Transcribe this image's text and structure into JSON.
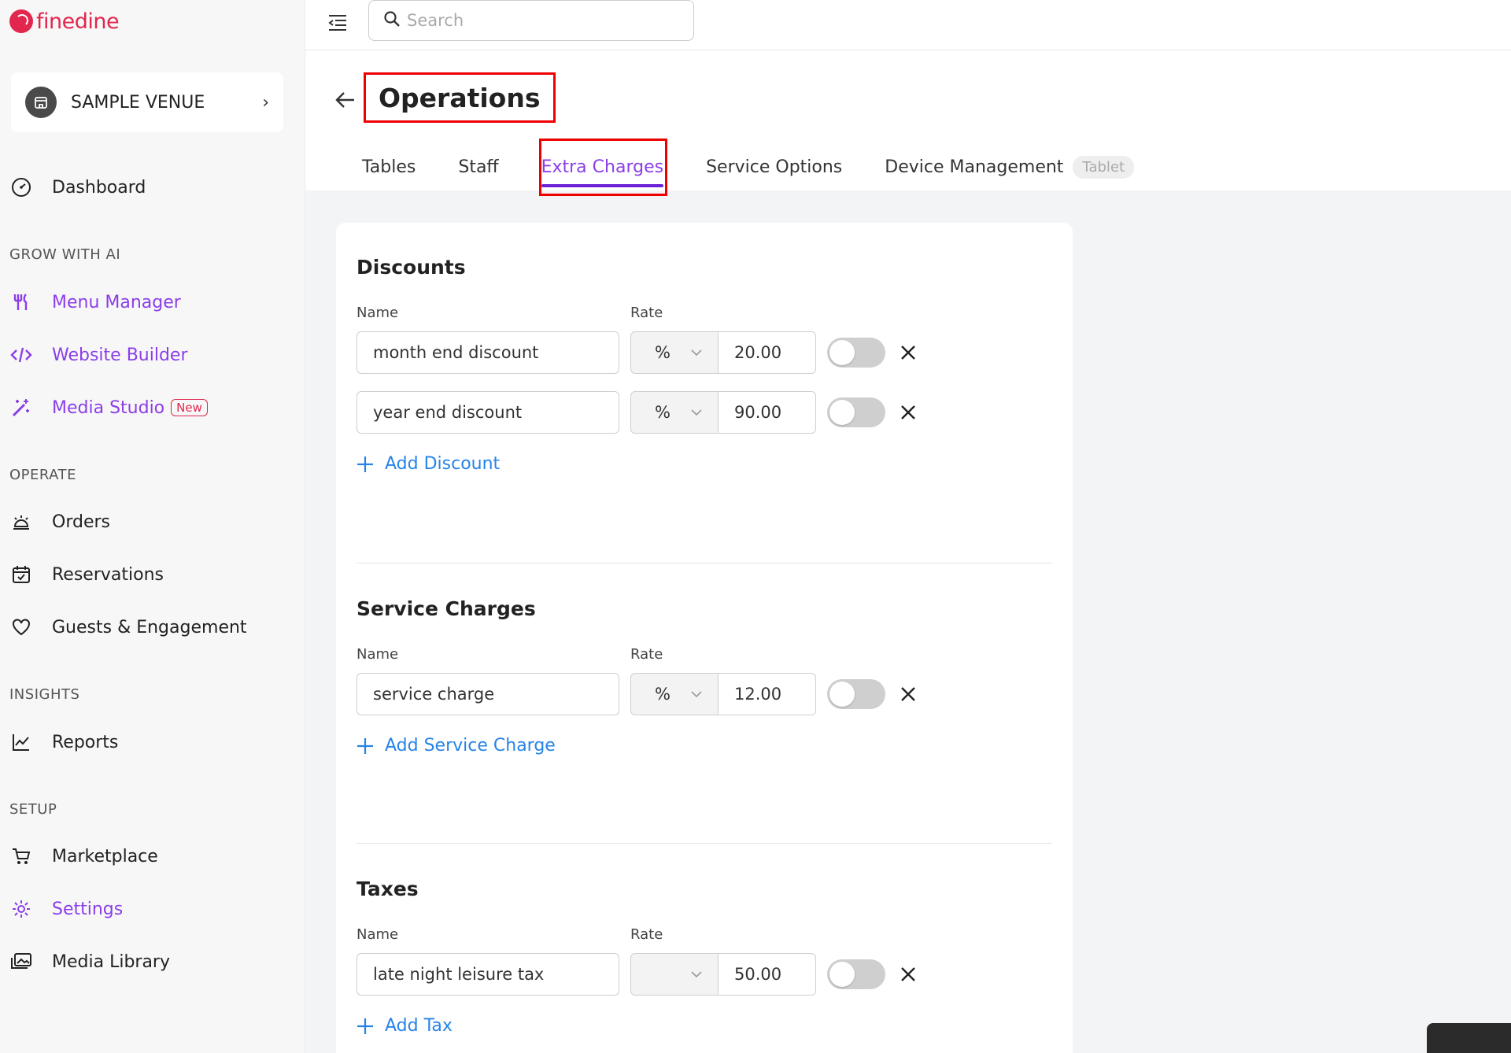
{
  "brand": {
    "name": "finedine",
    "color": "#e2264d"
  },
  "accent": {
    "purple": "#8b3ee8",
    "blue": "#2684e8",
    "highlight": "#e00000"
  },
  "sidebar": {
    "venue": "SAMPLE VENUE",
    "dashboard": "Dashboard",
    "sections": {
      "grow": "GROW WITH AI",
      "operate": "OPERATE",
      "insights": "INSIGHTS",
      "setup": "SETUP"
    },
    "items": {
      "menu_manager": "Menu Manager",
      "website_builder": "Website Builder",
      "media_studio": "Media Studio",
      "media_studio_badge": "New",
      "orders": "Orders",
      "reservations": "Reservations",
      "guests": "Guests & Engagement",
      "reports": "Reports",
      "marketplace": "Marketplace",
      "settings": "Settings",
      "media_library": "Media Library"
    }
  },
  "topbar": {
    "search_placeholder": "Search"
  },
  "header": {
    "title": "Operations",
    "tabs": [
      "Tables",
      "Staff",
      "Extra Charges",
      "Service Options",
      "Device Management"
    ],
    "active_tab": "Extra Charges",
    "device_badge": "Tablet"
  },
  "labels": {
    "name": "Name",
    "rate": "Rate"
  },
  "discounts": {
    "title": "Discounts",
    "rows": [
      {
        "name": "month end discount",
        "type": "%",
        "rate": "20.00",
        "enabled": false
      },
      {
        "name": "year end discount",
        "type": "%",
        "rate": "90.00",
        "enabled": false
      }
    ],
    "add": "Add Discount"
  },
  "service_charges": {
    "title": "Service Charges",
    "rows": [
      {
        "name": "service charge",
        "type": "%",
        "rate": "12.00",
        "enabled": false
      }
    ],
    "add": "Add Service Charge"
  },
  "taxes": {
    "title": "Taxes",
    "rows": [
      {
        "name": "late night leisure tax",
        "type": "",
        "rate": "50.00",
        "enabled": false
      }
    ],
    "add": "Add Tax"
  }
}
